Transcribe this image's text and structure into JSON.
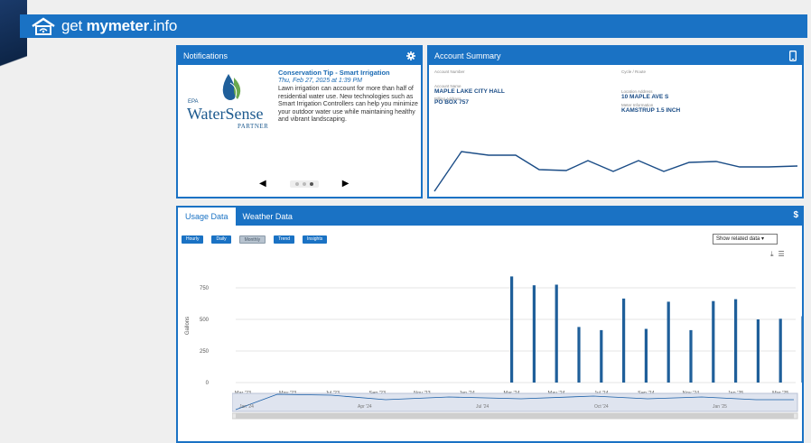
{
  "app": {
    "title_a": "get ",
    "title_b": "mymeter",
    "title_c": ".info"
  },
  "notifications": {
    "title": "Notifications",
    "epa": "EPA",
    "ws_name": "WaterSense",
    "ws_partner": "PARTNER",
    "tip_title": "Conservation Tip - Smart Irrigation",
    "tip_date": "Thu, Feb 27, 2025 at 1:39 PM",
    "tip_body": "Lawn irrigation can account for more than half of residential water use. New technologies such as Smart Irrigation Controllers can help you minimize your outdoor water use while maintaining healthy and vibrant landscaping.",
    "prev": "◀",
    "next": "▶"
  },
  "account": {
    "title": "Account Summary",
    "account_number_label": "Account Number",
    "cycle_label": "Cycle / Route",
    "account_name_label": "Account Name",
    "account_name": "MAPLE LAKE CITY HALL",
    "billing_label": "Billing Address",
    "billing": "PO BOX 757",
    "location_label": "Location Address",
    "location": "10 MAPLE AVE S",
    "meter_label": "Meter Information",
    "meter": "KAMSTRUP  1.5 INCH"
  },
  "usage": {
    "tabs": [
      "Usage Data",
      "Weather Data"
    ],
    "money_icon": "$",
    "buttons": [
      "Hourly",
      "Daily",
      "Monthly",
      "Trend",
      "Insights"
    ],
    "related": "Show related data",
    "nav_labels": [
      "Jan '24",
      "Apr '24",
      "Jul '24",
      "Oct '24",
      "Jan '25"
    ]
  },
  "chart_data": {
    "type": "bar",
    "ylabel": "Gallons",
    "yticks": [
      0,
      250,
      500,
      750
    ],
    "ylim": [
      0,
      900
    ],
    "xtick_labels": [
      "Mar '23",
      "May '23",
      "Jul '23",
      "Sep '23",
      "Nov '23",
      "Jan '24",
      "Mar '24",
      "May '24",
      "Jul '24",
      "Sep '24",
      "Nov '24",
      "Jan '25",
      "Mar '25"
    ],
    "categories": [
      "Mar '23",
      "Apr '23",
      "May '23",
      "Jun '23",
      "Jul '23",
      "Aug '23",
      "Sep '23",
      "Oct '23",
      "Nov '23",
      "Dec '23",
      "Jan '24",
      "Feb '24",
      "Mar '24",
      "Apr '24",
      "May '24",
      "Jun '24",
      "Jul '24",
      "Aug '24",
      "Sep '24",
      "Oct '24",
      "Nov '24",
      "Dec '24",
      "Jan '25",
      "Feb '25",
      "Mar '25"
    ],
    "values": [
      0,
      0,
      0,
      0,
      0,
      0,
      0,
      0,
      0,
      0,
      0,
      0,
      840,
      770,
      775,
      440,
      415,
      665,
      425,
      640,
      415,
      645,
      660,
      500,
      505,
      525
    ],
    "color": "#1f5f9a"
  }
}
